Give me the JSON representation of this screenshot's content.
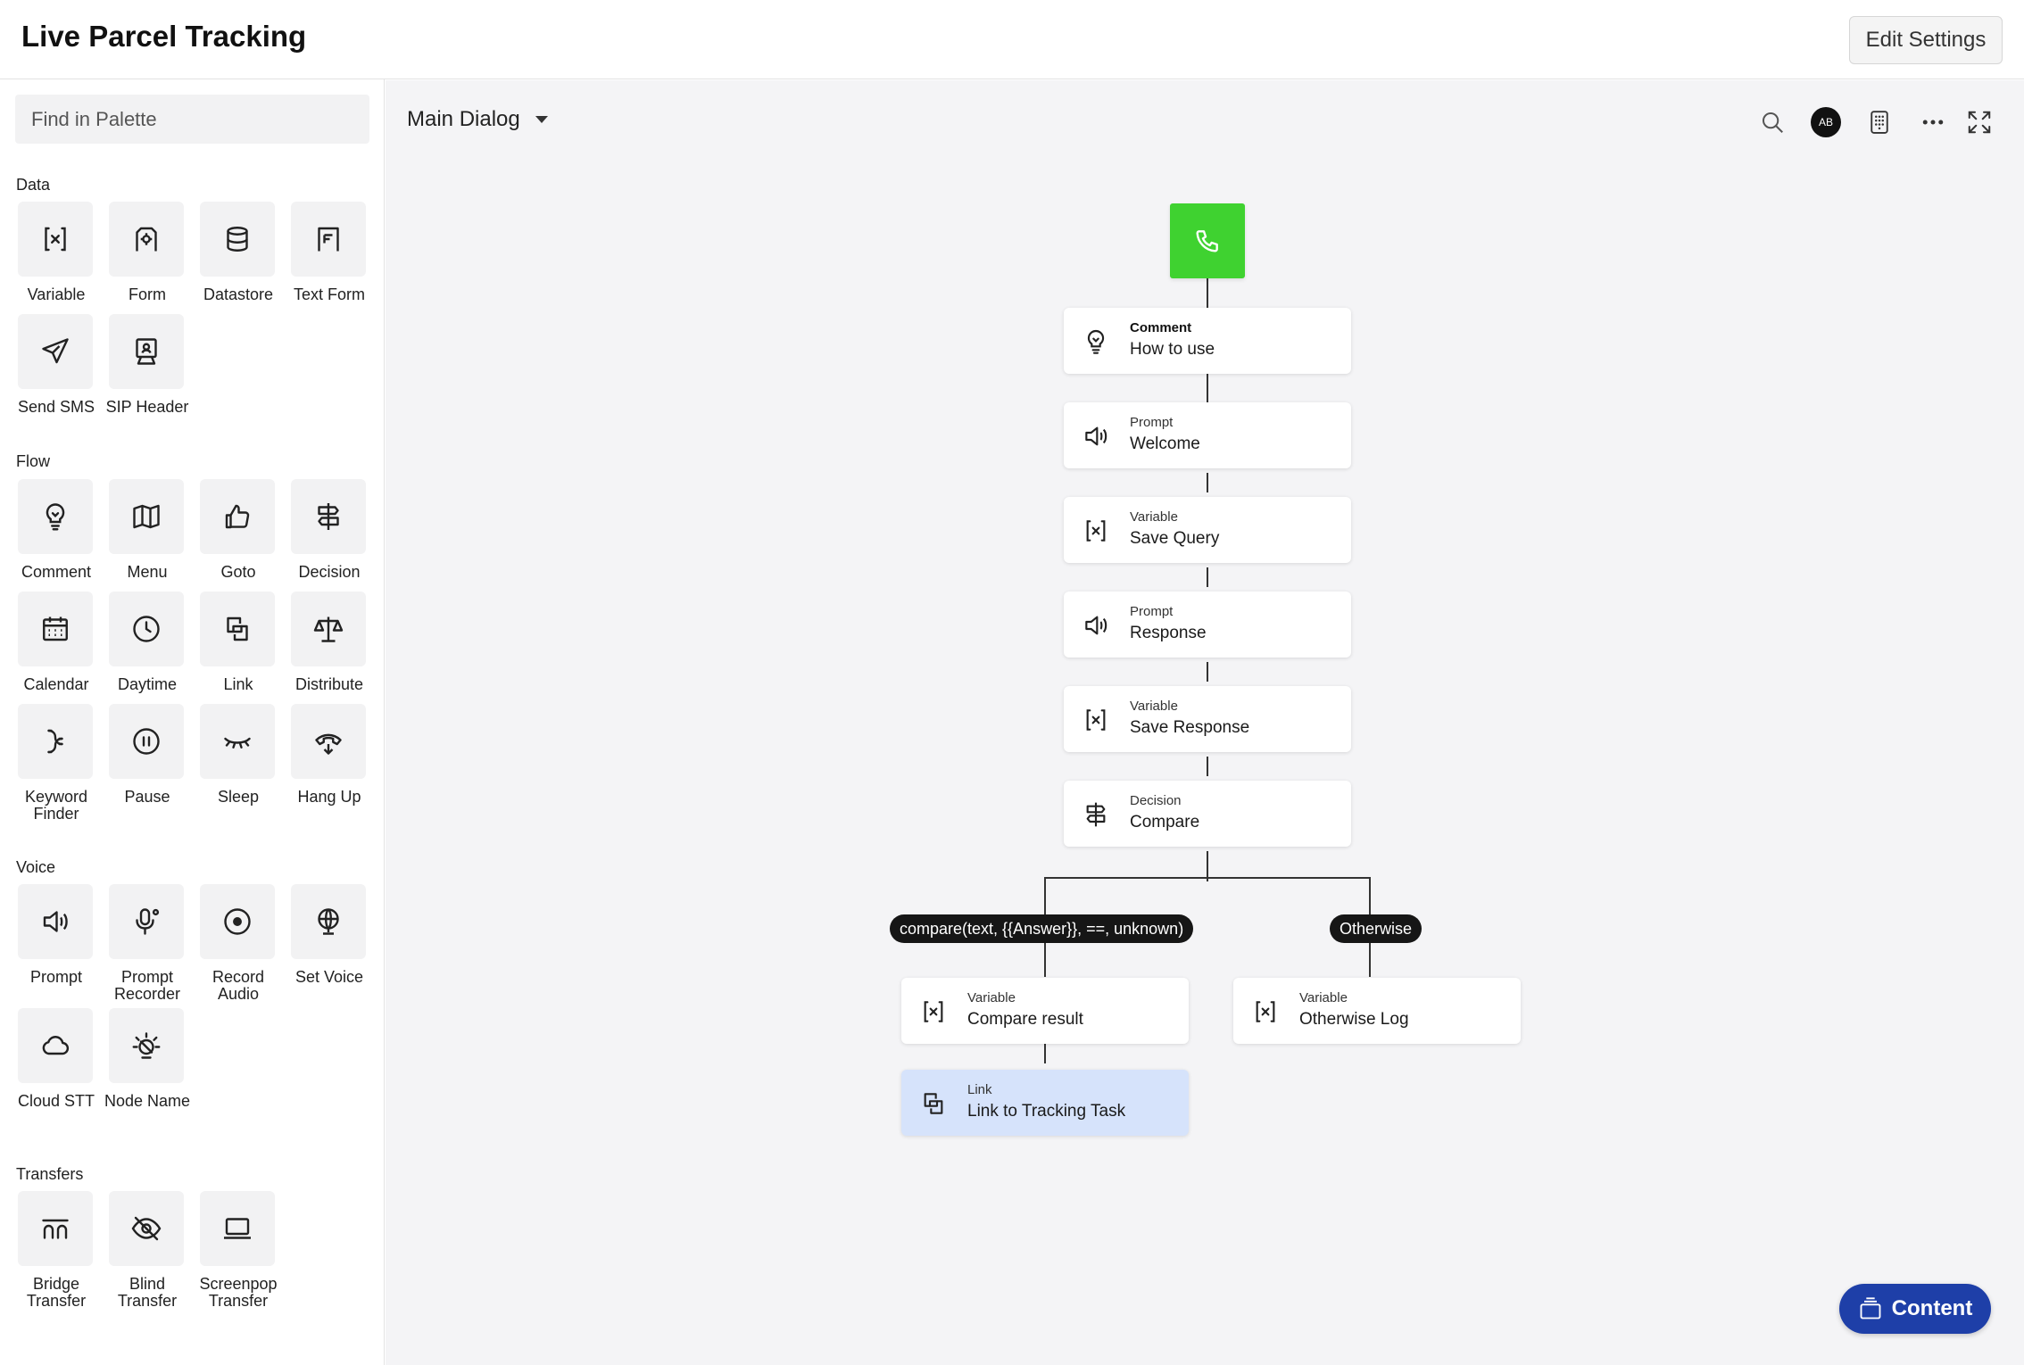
{
  "header": {
    "title": "Live Parcel Tracking",
    "edit_settings": "Edit Settings"
  },
  "sidebar": {
    "search_placeholder": "Find in Palette",
    "sections": {
      "data": {
        "title": "Data",
        "items": [
          {
            "label": "Variable",
            "icon": "variable-icon"
          },
          {
            "label": "Form",
            "icon": "form-icon"
          },
          {
            "label": "Datastore",
            "icon": "datastore-icon"
          },
          {
            "label": "Text Form",
            "icon": "text-form-icon"
          },
          {
            "label": "Send SMS",
            "icon": "send-sms-icon"
          },
          {
            "label": "SIP Header",
            "icon": "sip-header-icon"
          }
        ]
      },
      "flow": {
        "title": "Flow",
        "items": [
          {
            "label": "Comment",
            "icon": "lightbulb-icon"
          },
          {
            "label": "Menu",
            "icon": "map-icon"
          },
          {
            "label": "Goto",
            "icon": "thumbs-up-icon"
          },
          {
            "label": "Decision",
            "icon": "signpost-icon"
          },
          {
            "label": "Calendar",
            "icon": "calendar-icon"
          },
          {
            "label": "Daytime",
            "icon": "clock-icon"
          },
          {
            "label": "Link",
            "icon": "link-icon"
          },
          {
            "label": "Distribute",
            "icon": "scales-icon"
          },
          {
            "label": "Keyword Finder",
            "icon": "keyword-icon"
          },
          {
            "label": "Pause",
            "icon": "pause-icon"
          },
          {
            "label": "Sleep",
            "icon": "sleep-icon"
          },
          {
            "label": "Hang Up",
            "icon": "hang-up-icon"
          }
        ]
      },
      "voice": {
        "title": "Voice",
        "items": [
          {
            "label": "Prompt",
            "icon": "speaker-icon"
          },
          {
            "label": "Prompt Recorder",
            "icon": "microphone-icon"
          },
          {
            "label": "Record Audio",
            "icon": "record-icon"
          },
          {
            "label": "Set Voice",
            "icon": "globe-icon"
          },
          {
            "label": "Cloud STT",
            "icon": "cloud-icon"
          },
          {
            "label": "Node Name",
            "icon": "bulb-off-icon"
          }
        ]
      },
      "transfers": {
        "title": "Transfers",
        "items": [
          {
            "label": "Bridge Transfer",
            "icon": "bridge-icon"
          },
          {
            "label": "Blind Transfer",
            "icon": "eye-off-icon"
          },
          {
            "label": "Screenpop Transfer",
            "icon": "laptop-icon"
          }
        ]
      }
    }
  },
  "canvas": {
    "dialog_name": "Main Dialog",
    "avatar_initials": "AB",
    "nodes": [
      {
        "type": "Comment",
        "name": "How to use",
        "icon": "lightbulb-icon"
      },
      {
        "type": "Prompt",
        "name": "Welcome",
        "icon": "speaker-icon"
      },
      {
        "type": "Variable",
        "name": "Save Query",
        "icon": "variable-icon"
      },
      {
        "type": "Prompt",
        "name": "Response",
        "icon": "speaker-icon"
      },
      {
        "type": "Variable",
        "name": "Save Response",
        "icon": "variable-icon"
      },
      {
        "type": "Decision",
        "name": "Compare",
        "icon": "signpost-icon"
      }
    ],
    "branches": {
      "left_condition": "compare(text, {{Answer}}, ==, unknown)",
      "right_condition": "Otherwise",
      "left_node": {
        "type": "Variable",
        "name": "Compare result"
      },
      "right_node": {
        "type": "Variable",
        "name": "Otherwise Log"
      },
      "link_node": {
        "type": "Link",
        "name": "Link to Tracking Task"
      }
    },
    "content_button": "Content",
    "colors": {
      "start_node": "#3fd230",
      "content_button": "#1e3fa8",
      "link_node_highlight": "#d6e3fb"
    }
  }
}
